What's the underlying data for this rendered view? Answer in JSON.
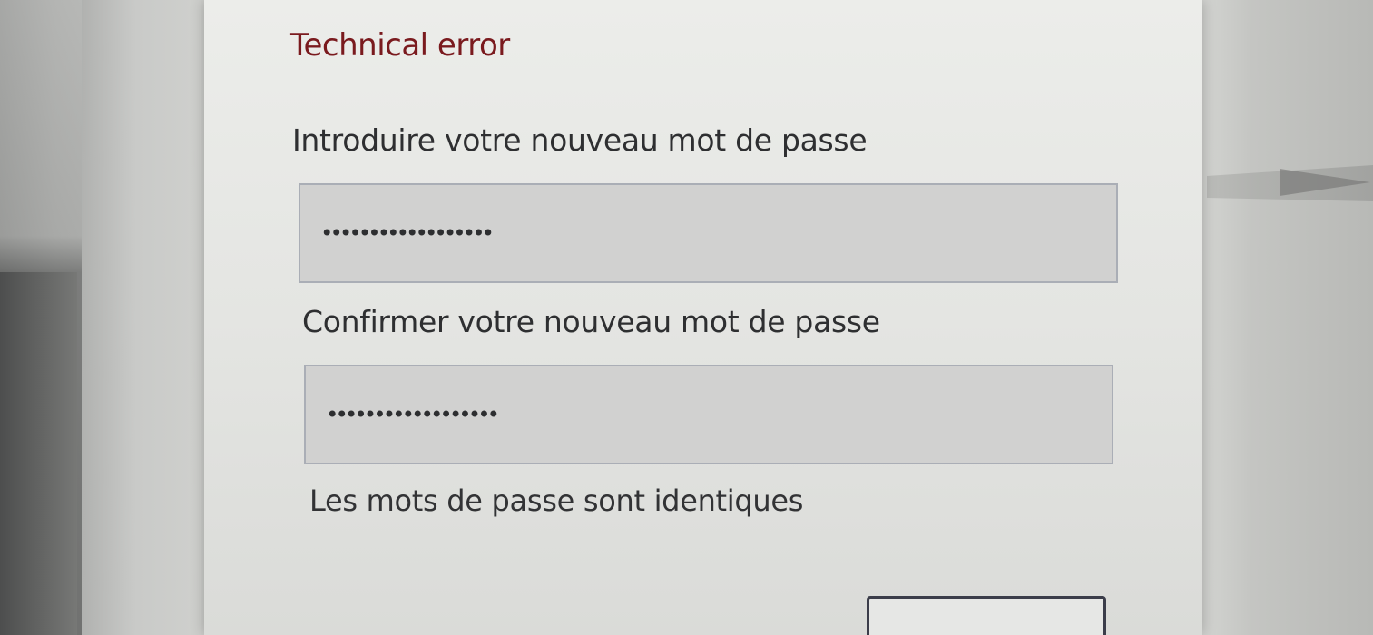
{
  "form": {
    "error_message": "Technical error",
    "new_password": {
      "label": "Introduire votre nouveau mot de passe",
      "value": "••••••••••••••••••"
    },
    "confirm_password": {
      "label": "Confirmer votre nouveau mot de passe",
      "value": "••••••••••••••••••"
    },
    "match_status": "Les mots de passe sont identiques"
  },
  "colors": {
    "error": "#7a1a1e",
    "field_background": "#d1d1d0",
    "field_border": "#aaaeb6",
    "button_border": "#3b3d4a"
  }
}
